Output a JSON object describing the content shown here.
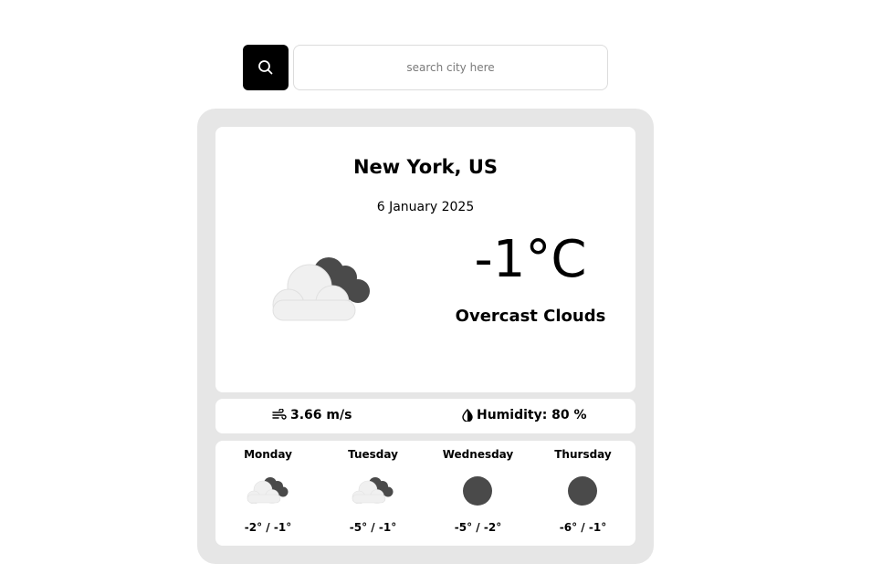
{
  "search": {
    "placeholder": "search city here",
    "button_icon": "search-icon"
  },
  "current": {
    "city": "New York, US",
    "date": "6 January 2025",
    "temperature": "-1°C",
    "description": "Overcast Clouds",
    "icon": "overcast-clouds-icon"
  },
  "stats": {
    "wind": "3.66 m/s",
    "wind_icon": "wind-icon",
    "humidity": "Humidity: 80 %",
    "humidity_icon": "humidity-icon"
  },
  "forecast": [
    {
      "day": "Monday",
      "temp": "-2° / -1°",
      "icon": "overcast-clouds-icon"
    },
    {
      "day": "Tuesday",
      "temp": "-5° / -1°",
      "icon": "overcast-clouds-icon"
    },
    {
      "day": "Wednesday",
      "temp": "-5° / -2°",
      "icon": "dark-circle-icon"
    },
    {
      "day": "Thursday",
      "temp": "-6° / -1°",
      "icon": "dark-circle-icon"
    }
  ],
  "colors": {
    "card_background": "#e6e6e6",
    "search_button": "#000000",
    "cloud_light": "#f0f0f0",
    "cloud_dark": "#4a4a4a"
  }
}
